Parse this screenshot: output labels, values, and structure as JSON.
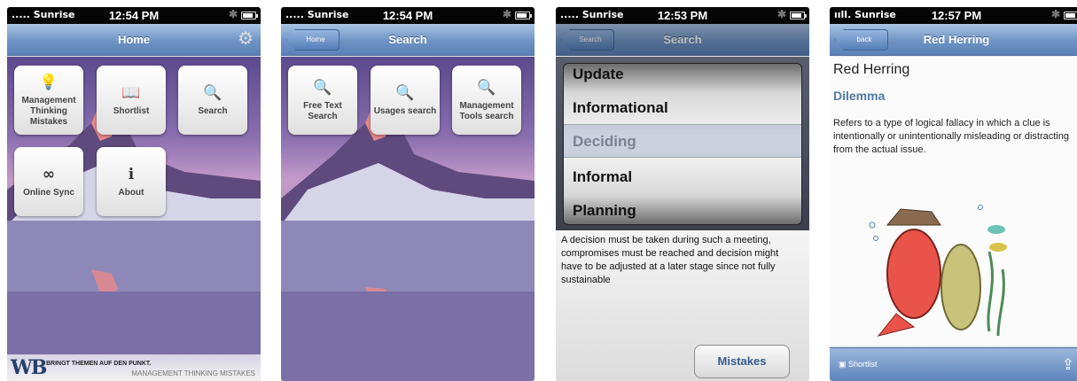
{
  "screens": [
    {
      "status": {
        "carrier": "..... Sunrise",
        "time": "12:54 PM"
      },
      "nav": {
        "title": "Home"
      },
      "tiles": [
        {
          "label": "Management Thinking Mistakes",
          "icon": "lightbulb-icon",
          "glyph": "💡"
        },
        {
          "label": "Shortlist",
          "icon": "book-icon",
          "glyph": "📖"
        },
        {
          "label": "Search",
          "icon": "search-icon",
          "glyph": "🔍"
        },
        {
          "label": "Online Sync",
          "icon": "infinity-icon",
          "glyph": "∞"
        },
        {
          "label": "About",
          "icon": "info-icon",
          "glyph": "ℹ"
        }
      ],
      "footer": {
        "logo": "WB",
        "slogan": "BRINGT THEMEN AUF DEN PUNKT.",
        "sub": "MANAGEMENT THINKING MISTAKES"
      }
    },
    {
      "status": {
        "carrier": "..... Sunrise",
        "time": "12:54 PM"
      },
      "nav": {
        "title": "Search",
        "back": "Home"
      },
      "tiles": [
        {
          "label": "Free Text Search",
          "icon": "search-icon",
          "glyph": "🔍"
        },
        {
          "label": "Usages search",
          "icon": "search-icon",
          "glyph": "🔍"
        },
        {
          "label": "Management Tools search",
          "icon": "search-icon",
          "glyph": "🔍"
        }
      ]
    },
    {
      "status": {
        "carrier": "..... Sunrise",
        "time": "12:53 PM"
      },
      "nav": {
        "title": "Search",
        "back": "Search"
      },
      "picker": {
        "items": [
          "Update",
          "Informational",
          "Deciding",
          "Informal",
          "Planning"
        ],
        "selected": "Deciding"
      },
      "description": "A decision must be taken during such a meeting, compromises must be reached and decision might have to be adjusted at a later stage since not fully sustainable",
      "button": "Mistakes"
    },
    {
      "status": {
        "carrier": "ııll. Sunrise",
        "time": "12:57 PM"
      },
      "nav": {
        "title": "Red Herring",
        "back": "back"
      },
      "heading": "Red Herring",
      "category": "Dilemma",
      "description": "Refers to a type of logical fallacy in which a clue is intentionally or unintentionally misleading or distracting from the actual issue.",
      "toolbar": {
        "shortlist": "Shortlist"
      }
    }
  ],
  "colors": {
    "nav": "#6f93c4",
    "accent": "#335b8f",
    "link": "#4d7aa8"
  }
}
